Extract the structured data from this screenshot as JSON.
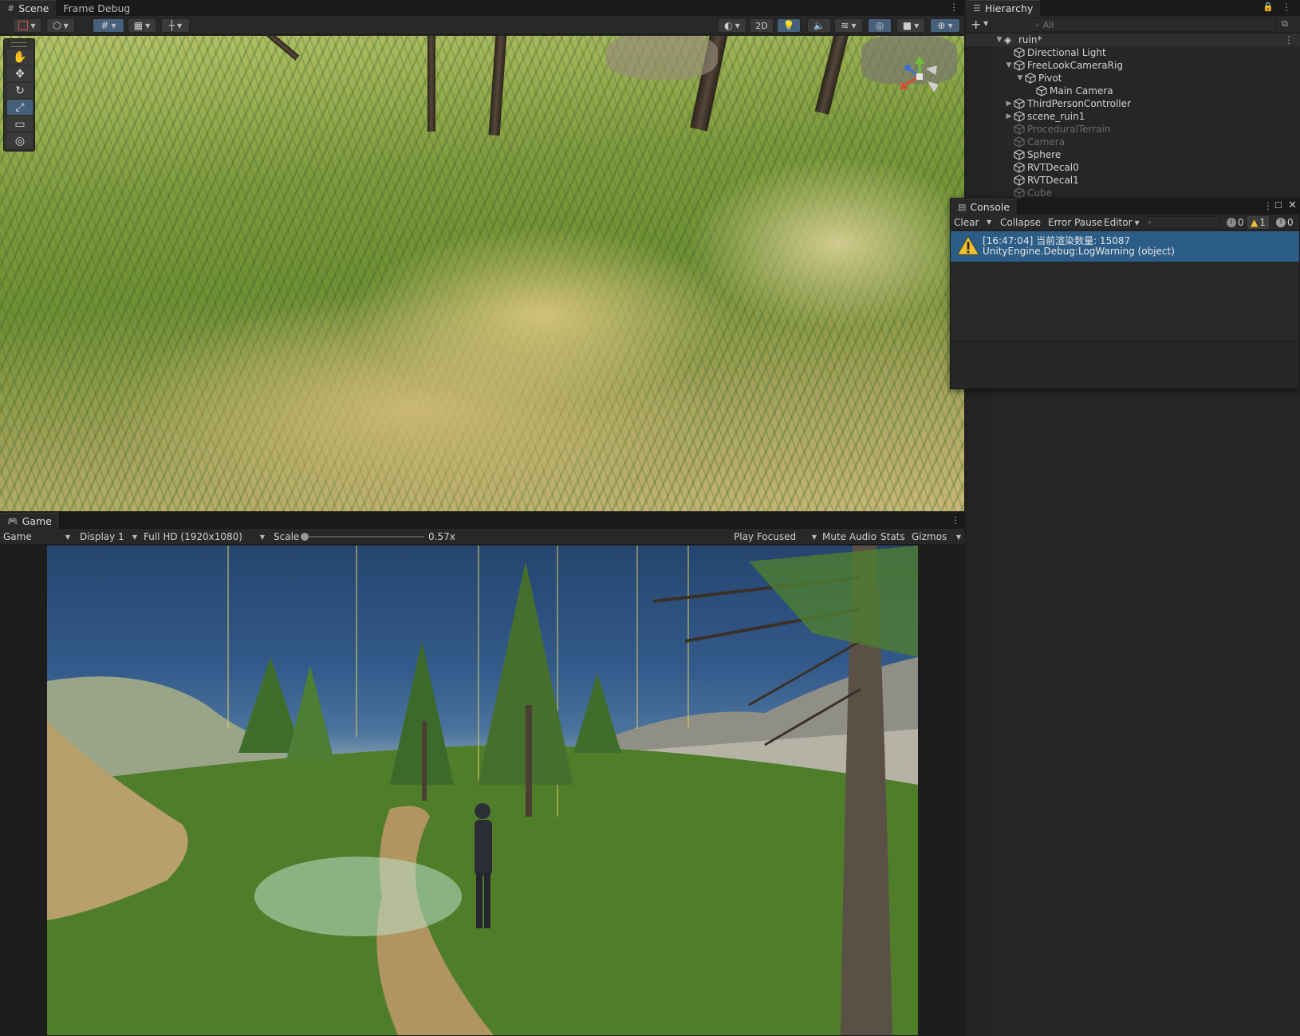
{
  "scene_panel": {
    "tabs": [
      "Scene",
      "Frame Debug"
    ],
    "toolbar": {
      "mode_2d": "2D"
    }
  },
  "hierarchy": {
    "title": "Hierarchy",
    "search_placeholder": "All",
    "scene_root": "ruin*",
    "items": [
      {
        "label": "Directional Light"
      },
      {
        "label": "FreeLookCameraRig"
      },
      {
        "label": "Pivot"
      },
      {
        "label": "Main Camera"
      },
      {
        "label": "ThirdPersonController"
      },
      {
        "label": "scene_ruin1"
      },
      {
        "label": "ProceduralTerrain"
      },
      {
        "label": "Camera"
      },
      {
        "label": "Sphere"
      },
      {
        "label": "RVTDecal0"
      },
      {
        "label": "RVTDecal1"
      },
      {
        "label": "Cube"
      }
    ]
  },
  "console": {
    "title": "Console",
    "toolbar": {
      "clear": "Clear",
      "collapse": "Collapse",
      "error_pause": "Error Pause",
      "editor": "Editor",
      "info_count": "0",
      "warning_count": "1",
      "error_count": "0"
    },
    "entries": [
      {
        "line1": "[16:47:04] 当前渲染数量: 15087",
        "line2": "UnityEngine.Debug:LogWarning (object)"
      }
    ]
  },
  "game_panel": {
    "tab": "Game",
    "toolbar": {
      "view_mode": "Game",
      "display": "Display 1",
      "resolution": "Full HD (1920x1080)",
      "scale_label": "Scale",
      "scale_value": "0.57x",
      "play_mode": "Play Focused",
      "mute_audio": "Mute Audio",
      "stats": "Stats",
      "gizmos": "Gizmos"
    },
    "scale_fraction": 0.0
  },
  "colors": {
    "selection_blue": "#2c5d87",
    "toggle_on": "#46607c",
    "warning_yellow": "#f0c030"
  }
}
